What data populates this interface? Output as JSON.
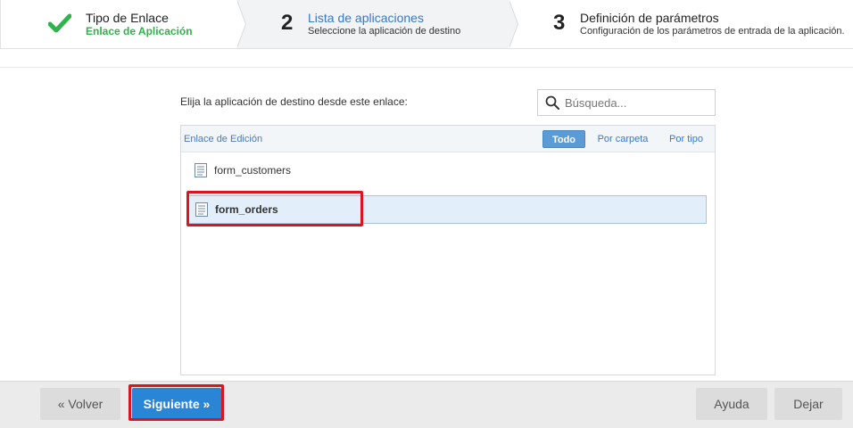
{
  "wizard": {
    "steps": [
      {
        "title": "Tipo de Enlace",
        "subtitle": "Enlace de Aplicación",
        "status": "done"
      },
      {
        "number": "2",
        "title": "Lista de aplicaciones",
        "subtitle": "Seleccione la aplicación de destino",
        "status": "active"
      },
      {
        "number": "3",
        "title": "Definición de parámetros",
        "subtitle": "Configuración de los parámetros de entrada de la aplicación.",
        "status": "pending"
      }
    ]
  },
  "main": {
    "instruction": "Elija la aplicación de destino desde este enlace:",
    "search": {
      "placeholder": "Búsqueda...",
      "value": ""
    },
    "panel": {
      "title": "Enlace de Edición",
      "filters": [
        {
          "label": "Todo",
          "active": true
        },
        {
          "label": "Por carpeta",
          "active": false
        },
        {
          "label": "Por tipo",
          "active": false
        }
      ],
      "apps": [
        {
          "name": "form_customers",
          "selected": false
        },
        {
          "name": "form_orders",
          "selected": true
        }
      ]
    }
  },
  "footer": {
    "back_label": "« Volver",
    "next_label": "Siguiente »",
    "help_label": "Ayuda",
    "leave_label": "Dejar"
  },
  "colors": {
    "accent": "#2a85d6",
    "done": "#2fb34a",
    "highlight": "#d9161d",
    "selected_row": "#e2eef9"
  },
  "icons": {
    "step1": "check-icon",
    "search": "search-icon",
    "app": "document-icon"
  }
}
